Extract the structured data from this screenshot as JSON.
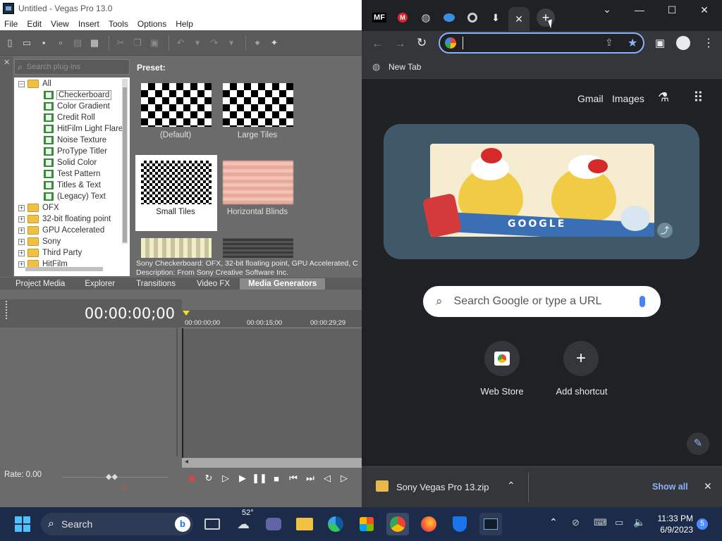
{
  "vegas": {
    "title": "Untitled - Vegas Pro 13.0",
    "menu": [
      "File",
      "Edit",
      "View",
      "Insert",
      "Tools",
      "Options",
      "Help"
    ],
    "search_placeholder": "Search plug-ins",
    "tree": {
      "all": "All",
      "children": [
        "Checkerboard",
        "Color Gradient",
        "Credit Roll",
        "HitFilm Light Flares",
        "Noise Texture",
        "ProType Titler",
        "Solid Color",
        "Test Pattern",
        "Titles & Text",
        "(Legacy) Text"
      ],
      "groups": [
        "OFX",
        "32-bit floating point",
        "GPU Accelerated",
        "Sony",
        "Third Party",
        "HitFilm"
      ]
    },
    "preset_label": "Preset:",
    "presets": [
      "(Default)",
      "Large Tiles",
      "Small Tiles",
      "Horizontal Blinds"
    ],
    "description_line1": "Sony Checkerboard: OFX, 32-bit floating point, GPU Accelerated, C",
    "description_line2": "Description: From Sony Creative Software Inc.",
    "tabs": [
      "Project Media",
      "Explorer",
      "Transitions",
      "Video FX",
      "Media Generators"
    ],
    "timecode": "00:00:00;00",
    "ruler": [
      "00:00:00;00",
      "00:00:15;00",
      "00:00:29;29"
    ],
    "rate": "Rate: 0.00"
  },
  "chrome": {
    "new_tab_label": "New Tab",
    "gmail": "Gmail",
    "images": "Images",
    "search_placeholder": "Search Google or type a URL",
    "shortcuts": [
      "Web Store",
      "Add shortcut"
    ],
    "doodle_text": "GOOGLE",
    "download_file": "Sony Vegas Pro 13.zip",
    "show_all": "Show all",
    "tab_favicon_mf": "MF"
  },
  "taskbar": {
    "search": "Search",
    "weather": "52°",
    "time": "11:33 PM",
    "date": "6/9/2023",
    "notifications": "5"
  }
}
